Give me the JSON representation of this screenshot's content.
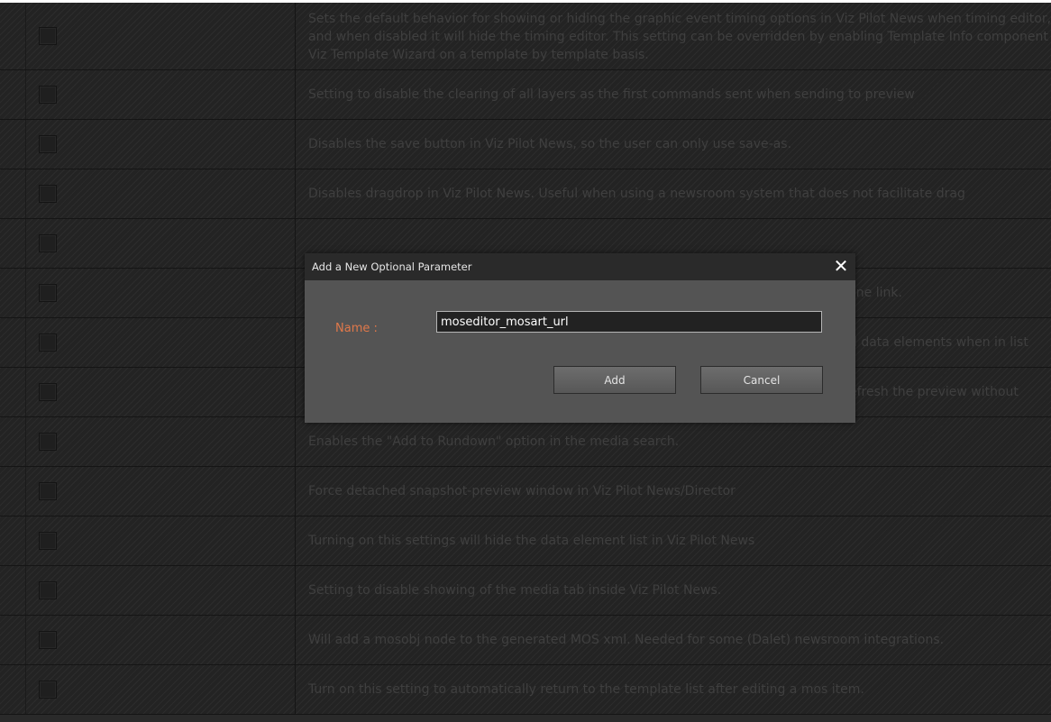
{
  "settings_rows": [
    {
      "description": "Sets the default behavior for showing or hiding the graphic event timing options in Viz Pilot News when timing editor, and when disabled it will hide the timing editor. This setting can be overridden by enabling Template Info component in Viz Template Wizard on a template by template basis."
    },
    {
      "description": "Setting to disable the clearing of all layers as the first commands sent when sending to preview"
    },
    {
      "description": "Disables the save button in Viz Pilot News, so the user can only use save-as."
    },
    {
      "description": "Disables dragdrop in Viz Pilot News. Useful when using a newsroom system that does not facilitate drag"
    },
    {
      "description": ""
    },
    {
      "description": "line link."
    },
    {
      "description": "d data elements when in list"
    },
    {
      "description": "efresh the preview without"
    },
    {
      "description": "Enables the \"Add to Rundown\" option in the media search."
    },
    {
      "description": "Force detached snapshot-preview window in Viz Pilot News/Director"
    },
    {
      "description": "Turning on this settings will hide the data element list in Viz Pilot News"
    },
    {
      "description": "Setting to disable showing of the media tab inside Viz Pilot News."
    },
    {
      "description": "Will add a mosobj node to the generated MOS xml. Needed for some (Dalet) newsroom integrations."
    },
    {
      "description": "Turn on this setting to automatically return to the template list after editing a mos item."
    }
  ],
  "dialog": {
    "title": "Add a New Optional Parameter",
    "close_glyph": "✕",
    "name_label": "Name :",
    "name_value": "moseditor_mosart_url",
    "add_label": "Add",
    "cancel_label": "Cancel"
  },
  "colors": {
    "label_accent": "#e0784a",
    "dialog_body": "#545454",
    "dialog_header": "#2a2a2a"
  }
}
